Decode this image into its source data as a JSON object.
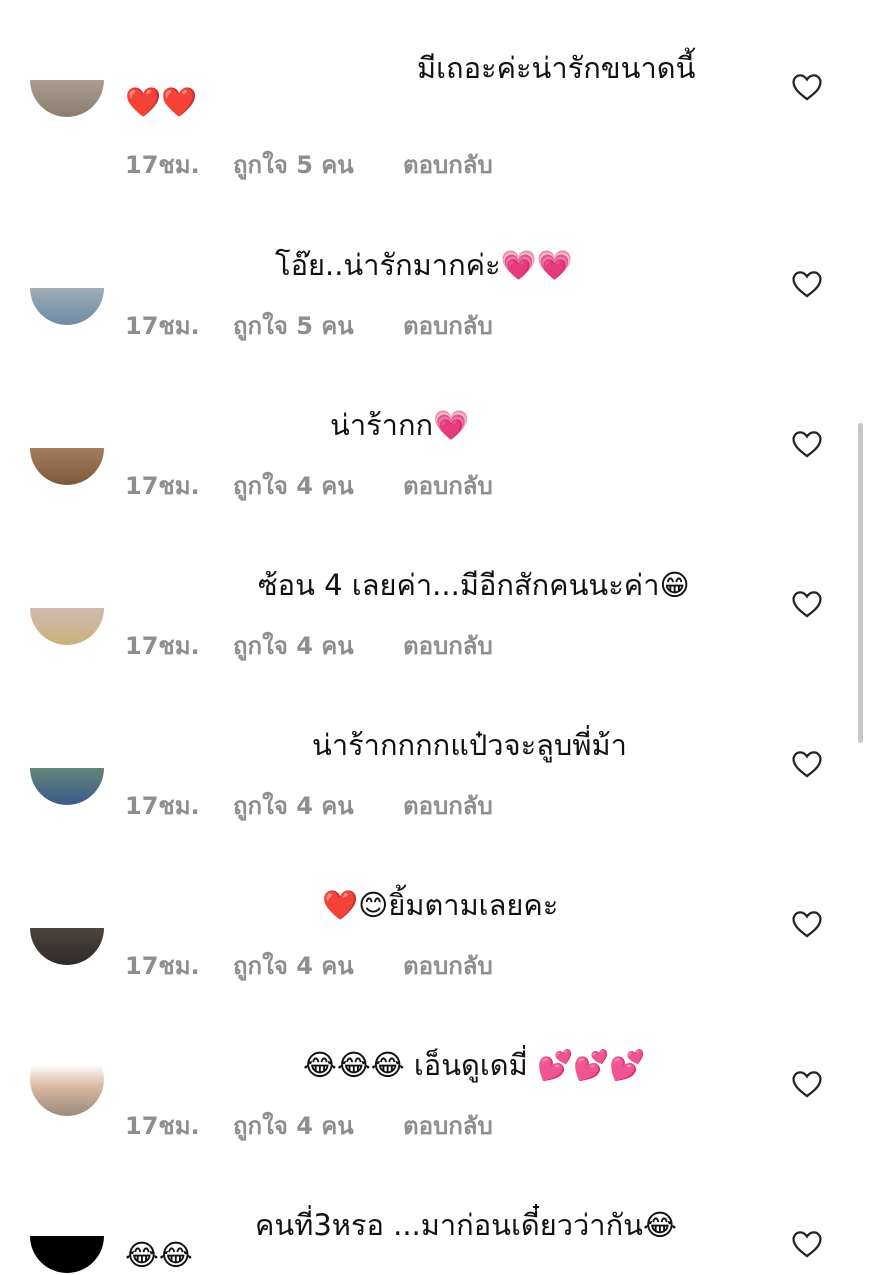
{
  "comments": [
    {
      "text": "มีเถอะค่ะน่ารักขนาดนี้",
      "text_line2": "❤️❤️",
      "time": "17ชม.",
      "likes": "ถูกใจ 5 คน",
      "reply": "ตอบกลับ",
      "avatar_colors": [
        "#8a7d6e",
        "#c9c0b2"
      ]
    },
    {
      "text": "โอ๊ย..น่ารักมากค่ะ💗💗",
      "text_line2": "",
      "time": "17ชม.",
      "likes": "ถูกใจ 5 คน",
      "reply": "ตอบกลับ",
      "avatar_colors": [
        "#6b8aa6",
        "#d9d2c4"
      ]
    },
    {
      "text": "น่าร้ากก💗",
      "text_line2": "",
      "time": "17ชม.",
      "likes": "ถูกใจ 4 คน",
      "reply": "ตอบกลับ",
      "avatar_colors": [
        "#7b5a3c",
        "#c9a27a"
      ]
    },
    {
      "text": "ซ้อน 4 เลยค่า...มีอีกสักคนนะค่า😁",
      "text_line2": "",
      "time": "17ชม.",
      "likes": "ถูกใจ 4 คน",
      "reply": "ตอบกลับ",
      "avatar_colors": [
        "#c9b27a",
        "#d7c2e6"
      ]
    },
    {
      "text": "น่าร้ากกกกแป๋วจะลูบพี่ม้า",
      "text_line2": "",
      "time": "17ชม.",
      "likes": "ถูกใจ 4 คน",
      "reply": "ตอบกลับ",
      "avatar_colors": [
        "#3a5a8a",
        "#8fae6a"
      ]
    },
    {
      "text": "❤️😊ยิ้มตามเลยคะ",
      "text_line2": "",
      "time": "17ชม.",
      "likes": "ถูกใจ 4 คน",
      "reply": "ตอบกลับ",
      "avatar_colors": [
        "#2e2a28",
        "#6b5e55"
      ]
    },
    {
      "text": "😂😂😂 เอ็นดูเดมี่ 💕💕💕",
      "text_line2": "",
      "time": "17ชม.",
      "likes": "ถูกใจ 4 คน",
      "reply": "ตอบกลับ",
      "avatar_colors": [
        "#d8b9a2",
        "#9c8a7c"
      ]
    },
    {
      "text": "คนที่3หรอ ...มาก่อนเดี๋ยวว่ากัน😂",
      "text_line2": "😂😂",
      "time": "",
      "likes": "",
      "reply": "",
      "avatar_colors": [
        "#000000",
        "#000000"
      ]
    }
  ],
  "colors": {
    "meta_text": "#8e8e8e",
    "heart_outline": "#262626",
    "scrollbar": "#c7c7c7"
  },
  "icons": {
    "like": "heart-outline-icon"
  }
}
